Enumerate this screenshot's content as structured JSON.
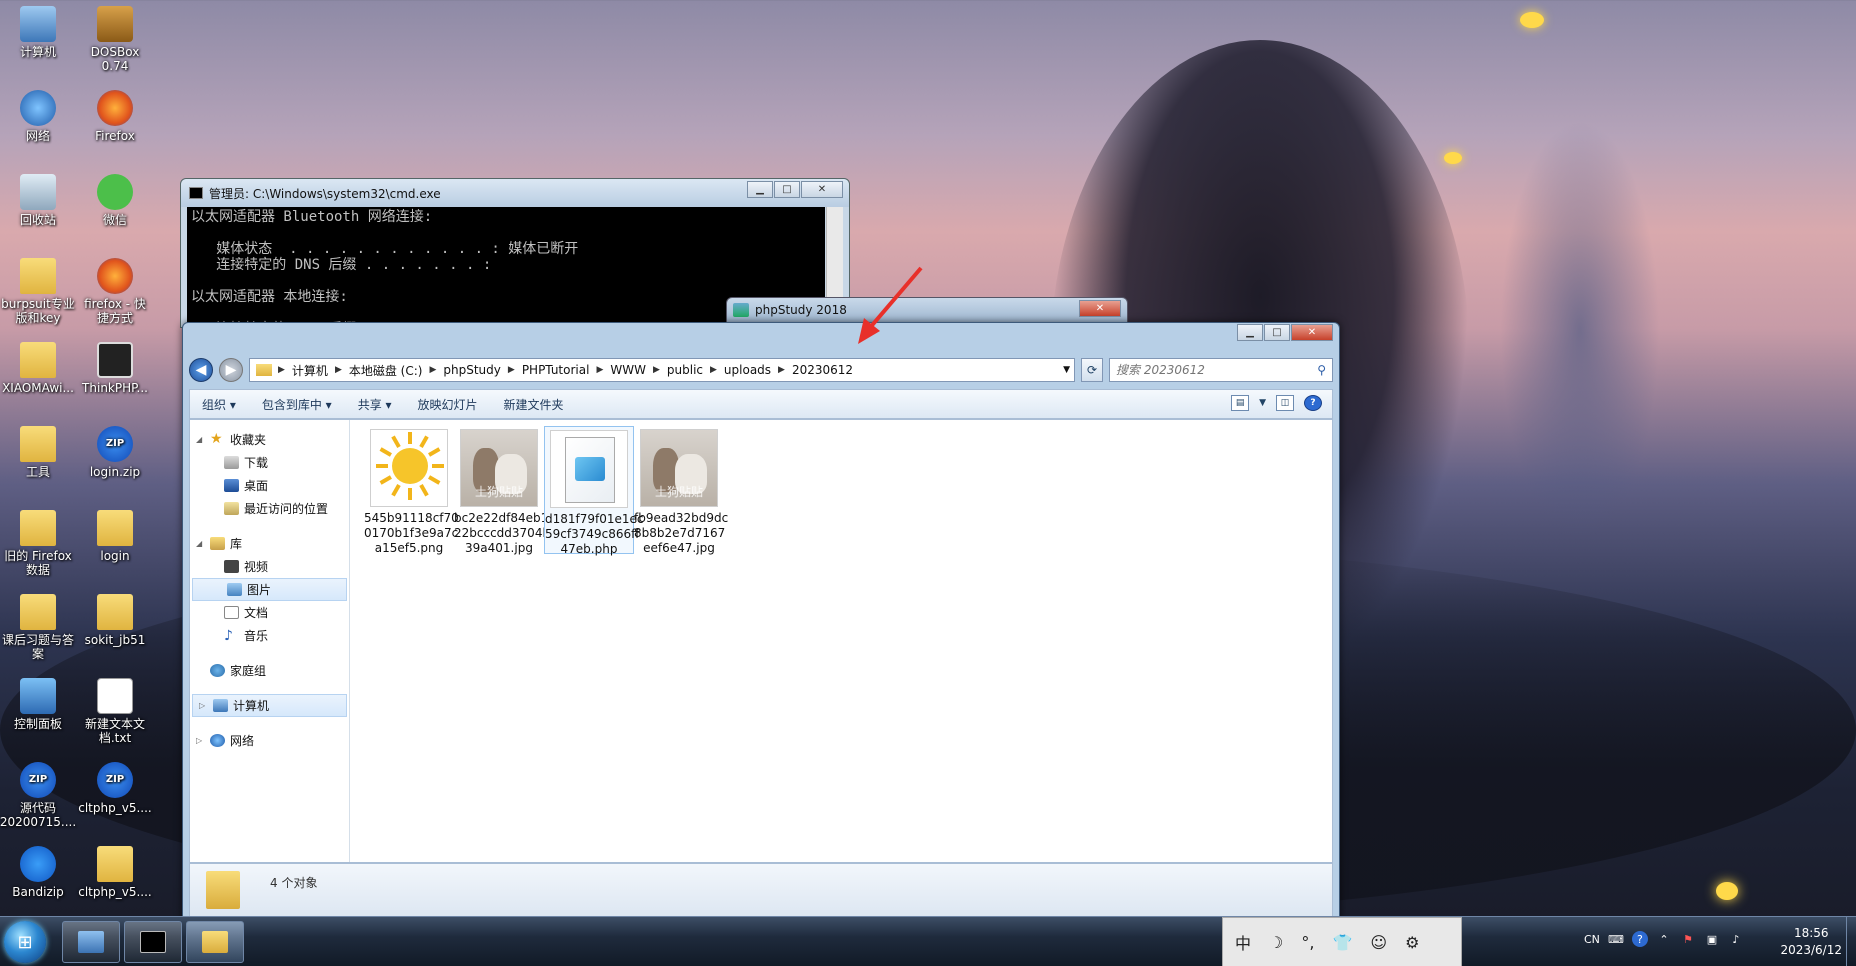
{
  "desktop_icons": [
    {
      "label": "计算机",
      "icon": "computer-icon"
    },
    {
      "label": "DOSBox\n0.74",
      "icon": "dosbox-icon"
    },
    {
      "label": "网络",
      "icon": "network-icon"
    },
    {
      "label": "Firefox",
      "icon": "firefox-icon"
    },
    {
      "label": "回收站",
      "icon": "recycle-bin-icon"
    },
    {
      "label": "微信",
      "icon": "wechat-icon"
    },
    {
      "label": "burpsuit专业\n版和key",
      "icon": "folder-icon"
    },
    {
      "label": "firefox - 快\n捷方式",
      "icon": "firefox-icon"
    },
    {
      "label": "XIAOMAwi...",
      "icon": "folder-icon"
    },
    {
      "label": "ThinkPHP...",
      "icon": "thinkphp-icon"
    },
    {
      "label": "工具",
      "icon": "folder-icon"
    },
    {
      "label": "login.zip",
      "icon": "zip-icon"
    },
    {
      "label": "旧的 Firefox\n数据",
      "icon": "folder-icon"
    },
    {
      "label": "login",
      "icon": "folder-icon"
    },
    {
      "label": "课后习题与答\n案",
      "icon": "folder-icon"
    },
    {
      "label": "sokit_jb51",
      "icon": "folder-icon"
    },
    {
      "label": "控制面板",
      "icon": "control-panel-icon"
    },
    {
      "label": "新建文本文\n档.txt",
      "icon": "text-file-icon"
    },
    {
      "label": "源代码\n20200715....",
      "icon": "zip-icon"
    },
    {
      "label": "cltphp_v5....",
      "icon": "zip-icon"
    },
    {
      "label": "Bandizip",
      "icon": "bandizip-icon"
    },
    {
      "label": "cltphp_v5....",
      "icon": "folder-icon"
    }
  ],
  "cmd": {
    "title": "管理员: C:\\Windows\\system32\\cmd.exe",
    "lines": [
      "以太网适配器 Bluetooth 网络连接:",
      "",
      "   媒体状态  . . . . . . . . . . . . : 媒体已断开",
      "   连接特定的 DNS 后缀 . . . . . . . :",
      "",
      "以太网适配器 本地连接:",
      "",
      "   连接特定的 DNS 后缀 . . . . . . . :"
    ]
  },
  "phpstudy": {
    "title": "phpStudy 2018"
  },
  "explorer": {
    "breadcrumb": [
      "计算机",
      "本地磁盘 (C:)",
      "phpStudy",
      "PHPTutorial",
      "WWW",
      "public",
      "uploads",
      "20230612"
    ],
    "search_placeholder": "搜索 20230612",
    "toolbar": [
      "组织 ▾",
      "包含到库中 ▾",
      "共享 ▾",
      "放映幻灯片",
      "新建文件夹"
    ],
    "nav": {
      "favorites": "收藏夹",
      "downloads": "下载",
      "desktop": "桌面",
      "recent": "最近访问的位置",
      "libraries": "库",
      "videos": "视频",
      "pictures": "图片",
      "documents": "文档",
      "music": "音乐",
      "homegroup": "家庭组",
      "computer": "计算机",
      "network": "网络"
    },
    "files": [
      {
        "name": "545b91118cf700170b1f3e9a7ca15ef5.png",
        "line1": "545b91118cf70",
        "line2": "0170b1f3e9a7c",
        "line3": "a15ef5.png",
        "thumb": "sun"
      },
      {
        "name": "bc2e22df84eb122bcccdd3704b39a401.jpg",
        "line1": "bc2e22df84eb1",
        "line2": "22bcccdd3704b",
        "line3": "39a401.jpg",
        "thumb": "dog"
      },
      {
        "name": "d181f79f01e1ec59cf3749c866ff47eb.php",
        "line1": "d181f79f01e1ec",
        "line2": "59cf3749c866ff",
        "line3": "47eb.php",
        "thumb": "doc"
      },
      {
        "name": "fb9ead32bd9dc8b8b2e7d7167eef6e47.jpg",
        "line1": "fb9ead32bd9dc",
        "line2": "8b8b2e7d7167",
        "line3": "eef6e47.jpg",
        "thumb": "dog"
      }
    ],
    "watermark": "土狗贴贴",
    "status": "4 个对象"
  },
  "ime": [
    "中",
    "☽",
    "°,",
    "👕",
    "☺",
    "⚙"
  ],
  "tray": {
    "lang": "CN"
  },
  "clock": {
    "time": "18:56",
    "date": "2023/6/12"
  },
  "colors": {
    "accent": "#2d6ad1",
    "arrow": "#e8302a"
  }
}
